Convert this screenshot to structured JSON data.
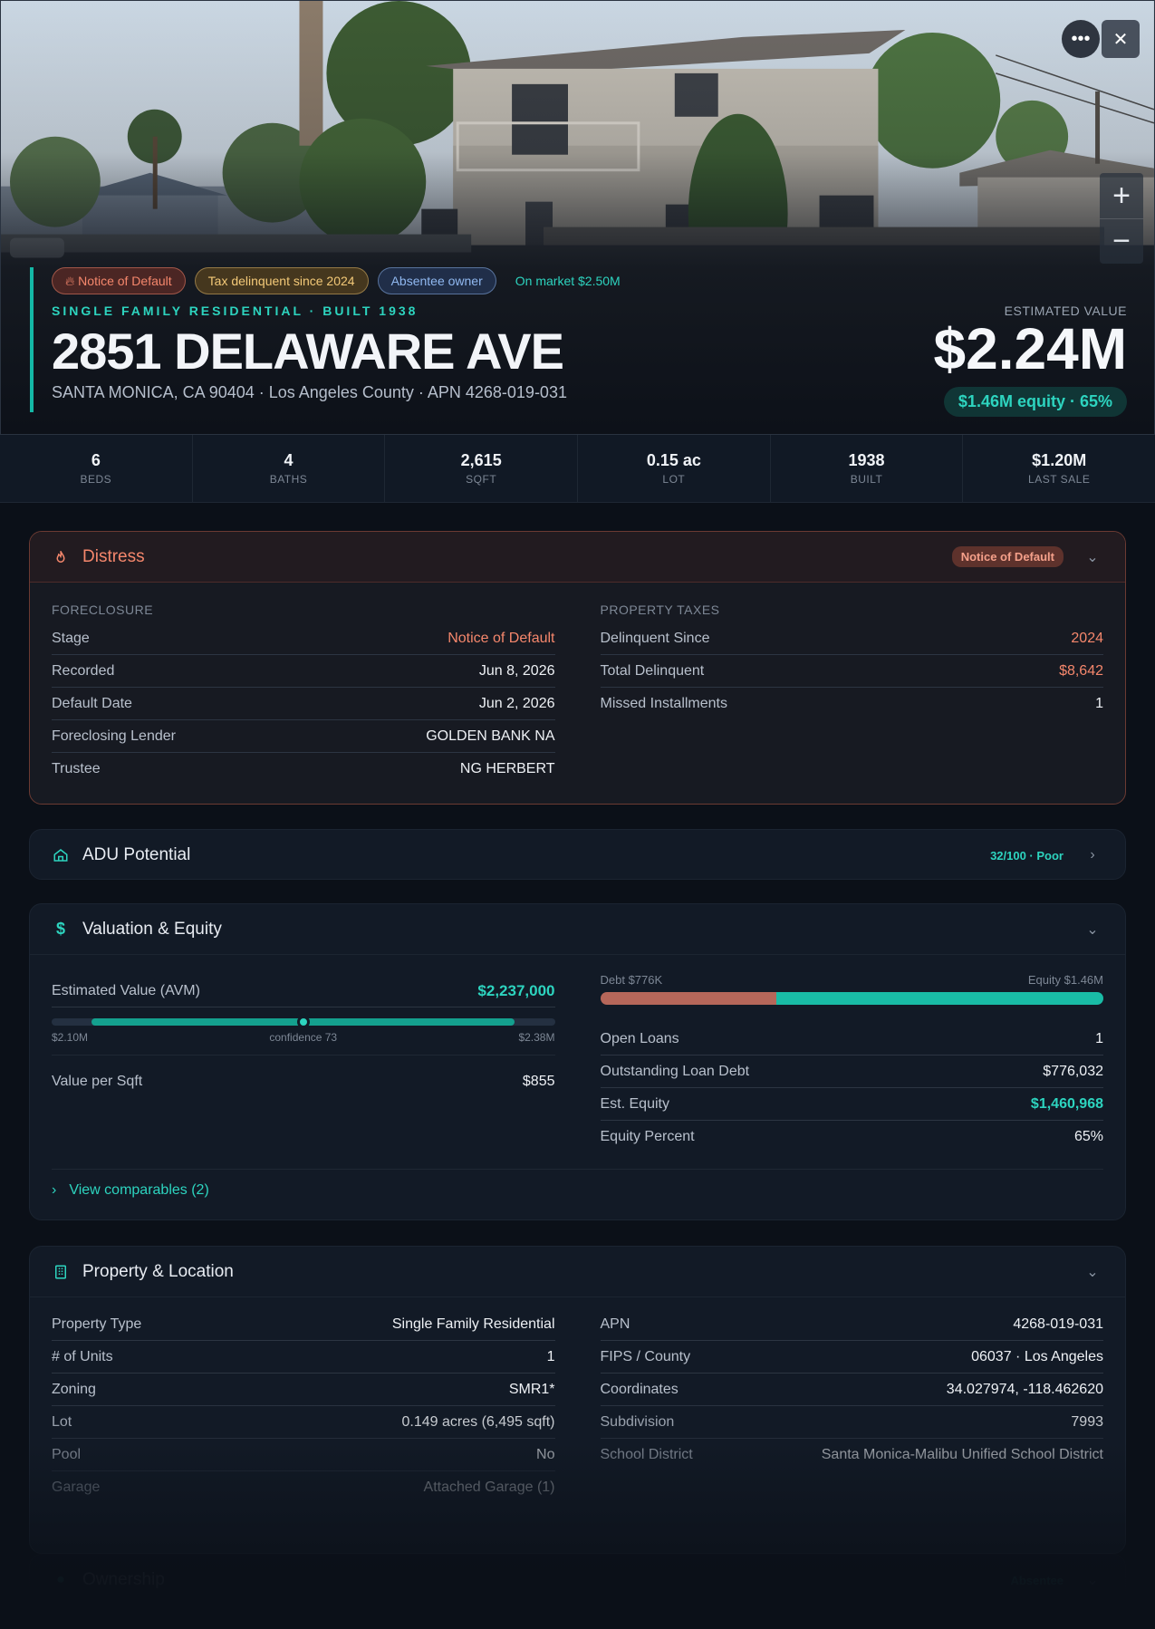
{
  "hero": {
    "badges": [
      "Notice of Default",
      "Tax delinquent since 2024",
      "Absentee owner",
      "On market $2.50M"
    ],
    "subtype": "SINGLE FAMILY RESIDENTIAL · BUILT 1938",
    "address": "2851 DELAWARE AVE",
    "sub_address": "SANTA MONICA, CA 90404 · Los Angeles County · APN 4268-019-031",
    "estimated_value_label": "ESTIMATED VALUE",
    "estimated_value": "$2.24M",
    "equity_pill": "$1.46M equity · 65%",
    "more_icon": "more-horizontal-icon",
    "close_icon": "close-icon",
    "zoom_in": "+",
    "zoom_out": "−"
  },
  "stats": [
    {
      "value": "6",
      "label": "BEDS"
    },
    {
      "value": "4",
      "label": "BATHS"
    },
    {
      "value": "2,615",
      "label": "SQFT"
    },
    {
      "value": "0.15 ac",
      "label": "LOT"
    },
    {
      "value": "1938",
      "label": "BUILT"
    },
    {
      "value": "$1.20M",
      "label": "LAST SALE"
    }
  ],
  "distress": {
    "title": "Distress",
    "badge": "Notice of Default",
    "foreclosure_label": "FORECLOSURE",
    "foreclosure": [
      {
        "k": "Stage",
        "v": "Notice of Default"
      },
      {
        "k": "Recorded",
        "v": "Jun 8, 2026"
      },
      {
        "k": "Default Date",
        "v": "Jun 2, 2026"
      },
      {
        "k": "Foreclosing Lender",
        "v": "GOLDEN BANK NA"
      },
      {
        "k": "Trustee",
        "v": "NG HERBERT"
      }
    ],
    "taxes_label": "PROPERTY TAXES",
    "taxes": [
      {
        "k": "Delinquent Since",
        "v": "2024"
      },
      {
        "k": "Total Delinquent",
        "v": "$8,642"
      },
      {
        "k": "Missed Installments",
        "v": "1"
      }
    ]
  },
  "adu": {
    "title": "ADU Potential",
    "score": "32/100 · Poor"
  },
  "valuation": {
    "title": "Valuation & Equity",
    "avm_label": "Estimated Value (AVM)",
    "avm_value": "$2,237,000",
    "range_low": "$2.10M",
    "range_high": "$2.38M",
    "confidence": "confidence 73",
    "range_fill_from": 0.08,
    "range_fill_to": 0.92,
    "range_point": 0.5,
    "vps_label": "Value per Sqft",
    "vps_value": "$855",
    "debt_label": "Debt $776K",
    "equity_label": "Equity $1.46M",
    "debt_fraction": 0.35,
    "rows": [
      {
        "k": "Open Loans",
        "v": "1"
      },
      {
        "k": "Outstanding Loan Debt",
        "v": "$776,032"
      },
      {
        "k": "Est. Equity",
        "v": "$1,460,968"
      },
      {
        "k": "Equity Percent",
        "v": "65%"
      }
    ],
    "comps_link": "View comparables (2)"
  },
  "property": {
    "title": "Property & Location",
    "left": [
      {
        "k": "Property Type",
        "v": "Single Family Residential"
      },
      {
        "k": "# of Units",
        "v": "1"
      },
      {
        "k": "Zoning",
        "v": "SMR1*"
      },
      {
        "k": "Lot",
        "v": "0.149 acres (6,495 sqft)"
      },
      {
        "k": "Pool",
        "v": "No"
      },
      {
        "k": "Garage",
        "v": "Attached Garage (1)"
      }
    ],
    "right": [
      {
        "k": "APN",
        "v": "4268-019-031"
      },
      {
        "k": "FIPS / County",
        "v": "06037 · Los Angeles"
      },
      {
        "k": "Coordinates",
        "v": "34.027974, -118.462620"
      },
      {
        "k": "Subdivision",
        "v": "7993"
      },
      {
        "k": "School District",
        "v": "Santa Monica-Malibu Unified School District"
      }
    ]
  },
  "ownership": {
    "title": "Ownership",
    "badge": "Absentee"
  },
  "colors": {
    "accent": "#2dd4bf",
    "danger": "#f5876c",
    "debt": "#b6675a",
    "equity": "#19bca6"
  }
}
